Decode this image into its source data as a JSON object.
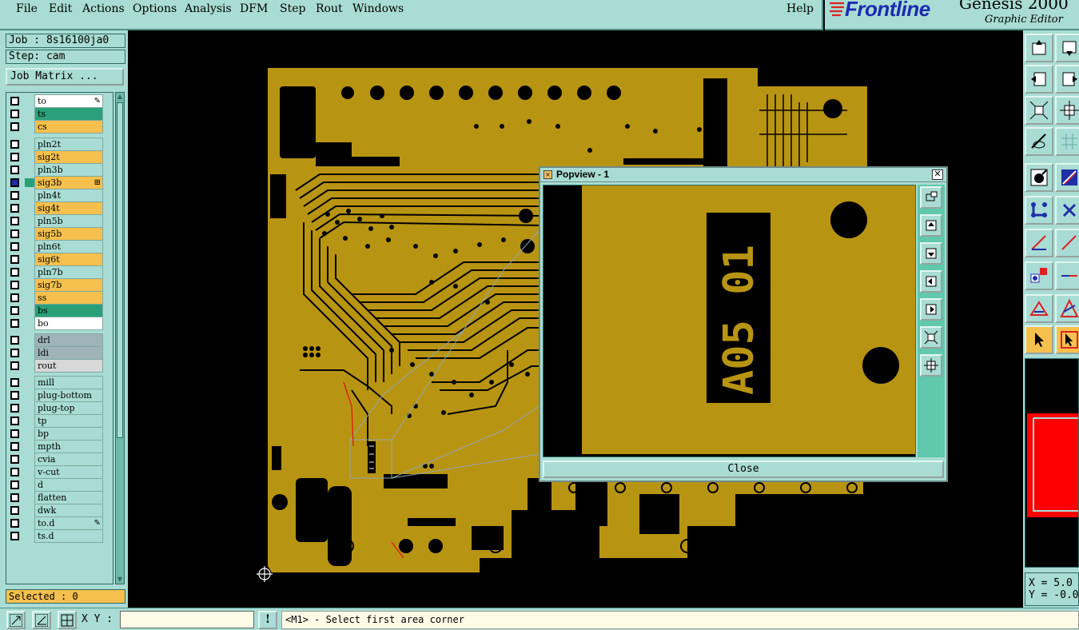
{
  "menubar": {
    "items": [
      "File",
      "Edit",
      "Actions",
      "Options",
      "Analysis",
      "DFM",
      "Step",
      "Rout",
      "Windows"
    ],
    "help": "Help"
  },
  "brand": {
    "name": "Frontline",
    "product": "Genesis 2000",
    "subtitle": "Graphic Editor"
  },
  "left_panel": {
    "job": "Job : 8s16100ja0",
    "step": "Step: cam",
    "job_matrix": "Job Matrix ...",
    "selected": "Selected : 0",
    "layers": [
      {
        "name": "to",
        "color": "#ffffff",
        "flag": "pen"
      },
      {
        "name": "ts",
        "color": "#2aa079"
      },
      {
        "name": "cs",
        "color": "#f5c04d"
      },
      {
        "name": "pln2t",
        "color": "#a9dcd4"
      },
      {
        "name": "sig2t",
        "color": "#f5c04d"
      },
      {
        "name": "pln3b",
        "color": "#a9dcd4"
      },
      {
        "name": "sig3b",
        "color": "#f5c04d",
        "active": true,
        "flag": "grid"
      },
      {
        "name": "pln4t",
        "color": "#a9dcd4"
      },
      {
        "name": "sig4t",
        "color": "#f5c04d"
      },
      {
        "name": "pln5b",
        "color": "#a9dcd4"
      },
      {
        "name": "sig5b",
        "color": "#f5c04d"
      },
      {
        "name": "pln6t",
        "color": "#a9dcd4"
      },
      {
        "name": "sig6t",
        "color": "#f5c04d"
      },
      {
        "name": "pln7b",
        "color": "#a9dcd4"
      },
      {
        "name": "sig7b",
        "color": "#f5c04d"
      },
      {
        "name": "ss",
        "color": "#f5c04d"
      },
      {
        "name": "bs",
        "color": "#2aa079"
      },
      {
        "name": "bo",
        "color": "#ffffff"
      },
      {
        "name": "drl",
        "color": "#9fb3b8"
      },
      {
        "name": "ldi",
        "color": "#9fb3b8"
      },
      {
        "name": "rout",
        "color": "#d8d8d8"
      },
      {
        "name": "mill",
        "color": "#a9dcd4"
      },
      {
        "name": "plug-bottom",
        "color": "#a9dcd4"
      },
      {
        "name": "plug-top",
        "color": "#a9dcd4"
      },
      {
        "name": "tp",
        "color": "#a9dcd4"
      },
      {
        "name": "bp",
        "color": "#a9dcd4"
      },
      {
        "name": "mpth",
        "color": "#a9dcd4"
      },
      {
        "name": "cvia",
        "color": "#a9dcd4"
      },
      {
        "name": "v-cut",
        "color": "#a9dcd4"
      },
      {
        "name": "d",
        "color": "#a9dcd4"
      },
      {
        "name": "flatten",
        "color": "#a9dcd4"
      },
      {
        "name": "dwk",
        "color": "#a9dcd4"
      },
      {
        "name": "to.d",
        "color": "#a9dcd4",
        "flag": "pen"
      },
      {
        "name": "ts.d",
        "color": "#a9dcd4"
      }
    ]
  },
  "popview": {
    "title": "Popview - 1",
    "close_label": "Close",
    "close_x": "✕",
    "silkscreen_text": "A05 01",
    "board_color": "#b89413"
  },
  "coords": {
    "x": "X = 5.0",
    "y": "Y = -0.0"
  },
  "statusbar": {
    "xy_label": "X Y :",
    "xy_value": "",
    "indicator": "!",
    "prompt": "<M1> - Select first area corner"
  },
  "colors": {
    "ui_bg": "#a9dcd4",
    "copper": "#b89413",
    "highlight": "#f5c04d",
    "brand_blue": "#1c2bb0",
    "preview_red": "#ff0000"
  }
}
